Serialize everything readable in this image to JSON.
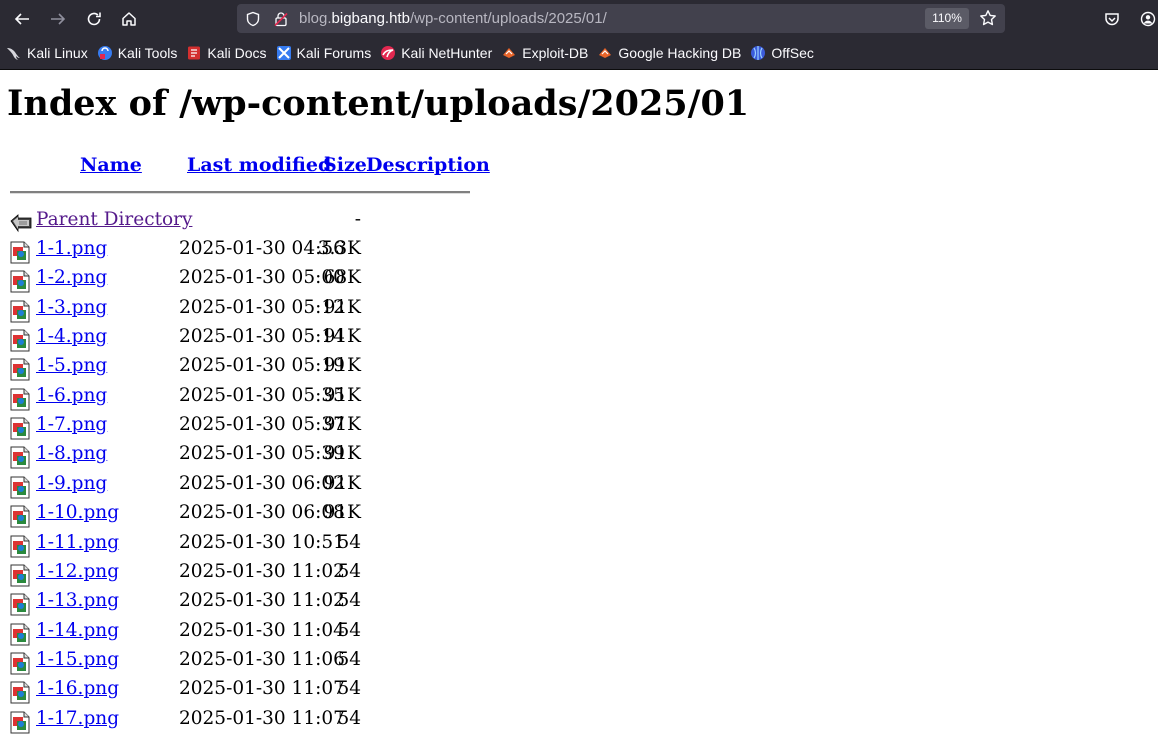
{
  "browser": {
    "url_prefix": "blog.",
    "url_host": "bigbang.htb",
    "url_path": "/wp-content/uploads/2025/01/",
    "zoom": "110%"
  },
  "bookmarks": [
    {
      "label": "Kali Linux",
      "icon": "kali-dragon-icon"
    },
    {
      "label": "Kali Tools",
      "icon": "kali-tools-icon"
    },
    {
      "label": "Kali Docs",
      "icon": "kali-docs-icon"
    },
    {
      "label": "Kali Forums",
      "icon": "kali-forums-icon"
    },
    {
      "label": "Kali NetHunter",
      "icon": "kali-nethunter-icon"
    },
    {
      "label": "Exploit-DB",
      "icon": "exploit-db-icon"
    },
    {
      "label": "Google Hacking DB",
      "icon": "ghdb-icon"
    },
    {
      "label": "OffSec",
      "icon": "offsec-icon"
    }
  ],
  "page": {
    "title": "Index of /wp-content/uploads/2025/01",
    "columns": {
      "name": "Name",
      "last_modified": "Last modified",
      "size": "Size",
      "description": "Description"
    },
    "parent": {
      "name": "Parent Directory",
      "size": "-"
    },
    "files": [
      {
        "name": "1-1.png",
        "modified": "2025-01-30 04:56",
        "size": "3.3K"
      },
      {
        "name": "1-2.png",
        "modified": "2025-01-30 05:00",
        "size": "68K"
      },
      {
        "name": "1-3.png",
        "modified": "2025-01-30 05:12",
        "size": "91K"
      },
      {
        "name": "1-4.png",
        "modified": "2025-01-30 05:14",
        "size": "91K"
      },
      {
        "name": "1-5.png",
        "modified": "2025-01-30 05:19",
        "size": "91K"
      },
      {
        "name": "1-6.png",
        "modified": "2025-01-30 05:35",
        "size": "91K"
      },
      {
        "name": "1-7.png",
        "modified": "2025-01-30 05:37",
        "size": "91K"
      },
      {
        "name": "1-8.png",
        "modified": "2025-01-30 05:39",
        "size": "91K"
      },
      {
        "name": "1-9.png",
        "modified": "2025-01-30 06:02",
        "size": "91K"
      },
      {
        "name": "1-10.png",
        "modified": "2025-01-30 06:08",
        "size": "91K"
      },
      {
        "name": "1-11.png",
        "modified": "2025-01-30 10:51",
        "size": "54"
      },
      {
        "name": "1-12.png",
        "modified": "2025-01-30 11:02",
        "size": "54"
      },
      {
        "name": "1-13.png",
        "modified": "2025-01-30 11:02",
        "size": "54"
      },
      {
        "name": "1-14.png",
        "modified": "2025-01-30 11:04",
        "size": "54"
      },
      {
        "name": "1-15.png",
        "modified": "2025-01-30 11:06",
        "size": "54"
      },
      {
        "name": "1-16.png",
        "modified": "2025-01-30 11:07",
        "size": "54"
      },
      {
        "name": "1-17.png",
        "modified": "2025-01-30 11:07",
        "size": "54"
      }
    ]
  }
}
